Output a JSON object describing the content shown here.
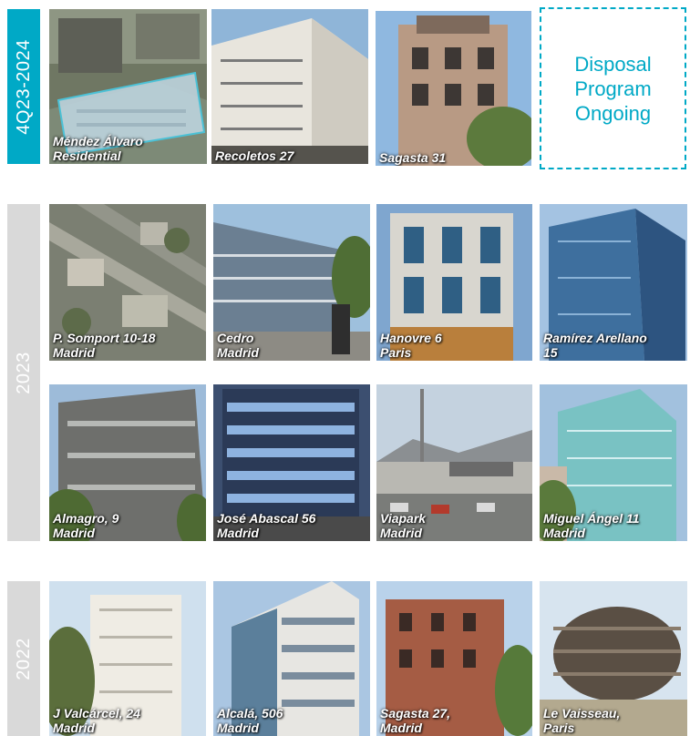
{
  "bands": {
    "q4": "4Q23-2024",
    "y2023": "2023",
    "y2022": "2022"
  },
  "disposal": {
    "line1": "Disposal",
    "line2": "Program",
    "line3": "Ongoing"
  },
  "colors": {
    "accent": "#00a9c6",
    "band_gray": "#d9d9d9"
  },
  "sections": {
    "q4": [
      {
        "line1": "Méndez Álvaro",
        "line2": "Residential"
      },
      {
        "line1": "Recoletos 27",
        "line2": ""
      },
      {
        "line1": "Sagasta 31",
        "line2": ""
      }
    ],
    "y2023_row1": [
      {
        "line1": "P. Somport 10-18",
        "line2": "Madrid"
      },
      {
        "line1": "Cedro",
        "line2": "Madrid"
      },
      {
        "line1": "Hanovre 6",
        "line2": "Paris"
      },
      {
        "line1": "Ramírez Arellano",
        "line2": "15"
      }
    ],
    "y2023_row2": [
      {
        "line1": "Almagro, 9",
        "line2": "Madrid"
      },
      {
        "line1": "José Abascal 56",
        "line2": "Madrid"
      },
      {
        "line1": "Viapark",
        "line2": "Madrid"
      },
      {
        "line1": "Miguel Ángel 11",
        "line2": "Madrid"
      }
    ],
    "y2022": [
      {
        "line1": "J Valcárcel, 24",
        "line2": "Madrid"
      },
      {
        "line1": "Alcalá, 506",
        "line2": "Madrid"
      },
      {
        "line1": "Sagasta 27,",
        "line2": "Madrid"
      },
      {
        "line1": "Le Vaisseau,",
        "line2": "Paris"
      }
    ]
  }
}
